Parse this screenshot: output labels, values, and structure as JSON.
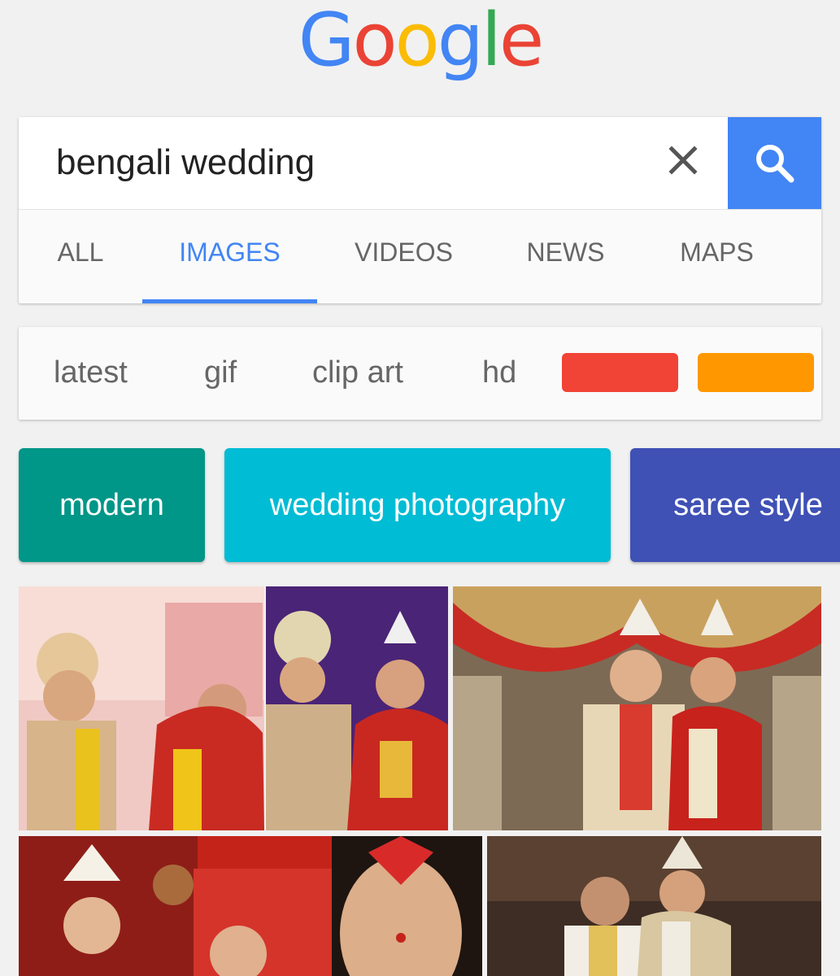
{
  "logo": {
    "letters": [
      "G",
      "o",
      "o",
      "g",
      "l",
      "e"
    ],
    "colors": [
      "#4285f4",
      "#ea4335",
      "#fbbc05",
      "#4285f4",
      "#34a853",
      "#ea4335"
    ]
  },
  "search": {
    "query": "bengali wedding"
  },
  "tabs": [
    {
      "label": "ALL"
    },
    {
      "label": "IMAGES"
    },
    {
      "label": "VIDEOS"
    },
    {
      "label": "NEWS"
    },
    {
      "label": "MAPS"
    }
  ],
  "active_tab": "IMAGES",
  "filters": [
    {
      "label": "latest"
    },
    {
      "label": "gif"
    },
    {
      "label": "clip art"
    },
    {
      "label": "hd"
    }
  ],
  "color_filters": [
    "#f14336",
    "#ff9800"
  ],
  "related_searches": [
    {
      "label": "modern",
      "color": "#009688"
    },
    {
      "label": "wedding photography",
      "color": "#00bcd4"
    },
    {
      "label": "saree style",
      "color": "#3f51b5"
    }
  ],
  "accent_color": "#4285f4"
}
